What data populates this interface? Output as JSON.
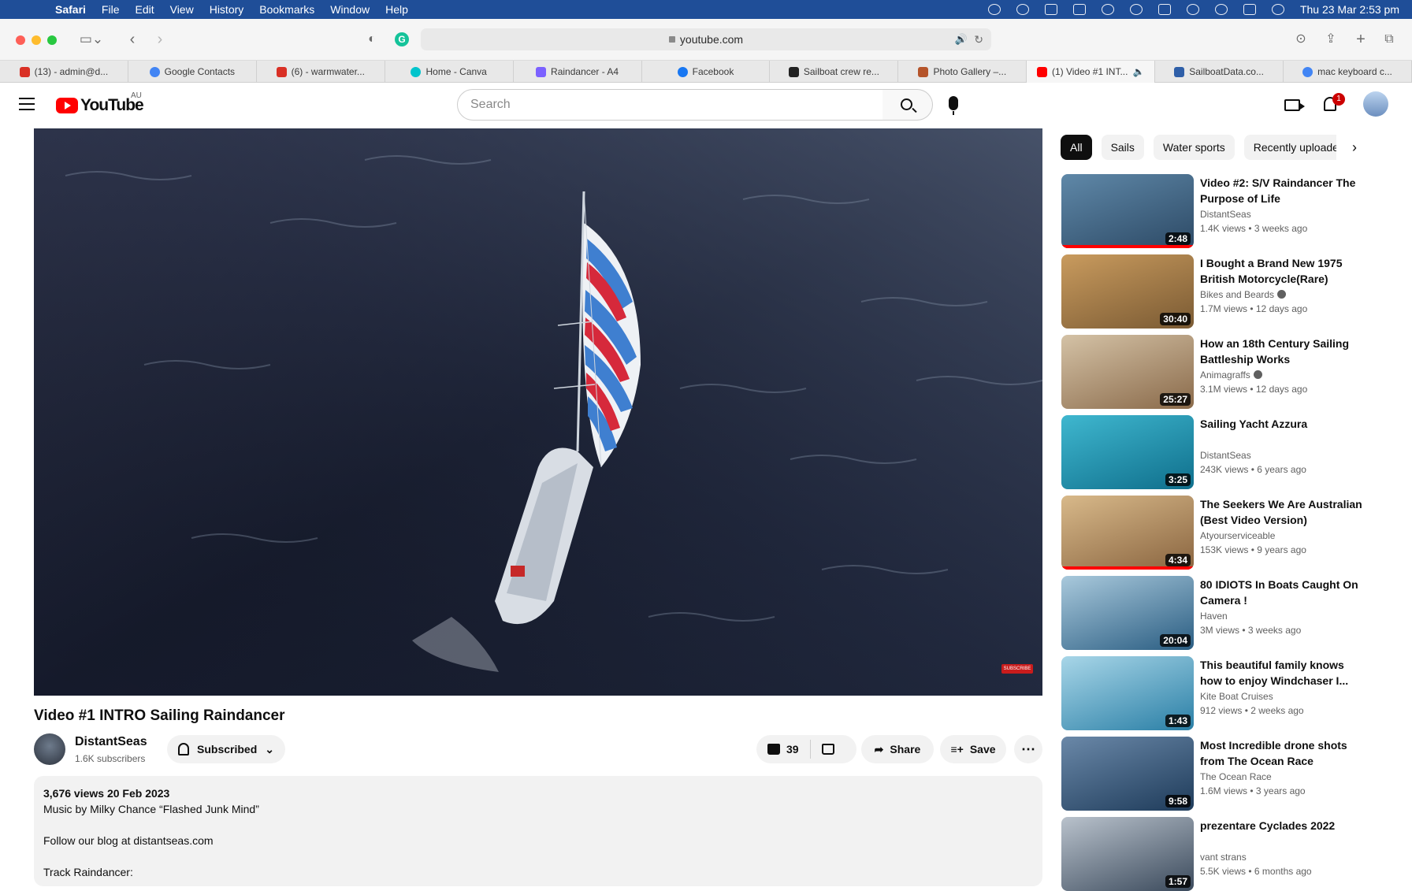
{
  "menubar": {
    "app": "Safari",
    "items": [
      "File",
      "Edit",
      "View",
      "History",
      "Bookmarks",
      "Window",
      "Help"
    ],
    "clock": "Thu 23 Mar  2:53 pm"
  },
  "toolbar": {
    "address": "youtube.com"
  },
  "tabs": [
    {
      "label": "(13) - admin@d...",
      "color": "#d93025"
    },
    {
      "label": "Google Contacts",
      "color": "#4285f4"
    },
    {
      "label": "(6) - warmwater...",
      "color": "#d93025"
    },
    {
      "label": "Home - Canva",
      "color": "#00c4cc"
    },
    {
      "label": "Raindancer - A4",
      "color": "#7b61ff"
    },
    {
      "label": "Facebook",
      "color": "#1877f2"
    },
    {
      "label": "Sailboat crew re...",
      "color": "#222222"
    },
    {
      "label": "Photo Gallery –...",
      "color": "#b5542a"
    },
    {
      "label": "(1) Video #1 INT...",
      "color": "#ff0000"
    },
    {
      "label": "SailboatData.co...",
      "color": "#2f5fa8"
    },
    {
      "label": "mac keyboard c...",
      "color": "#4285f4"
    }
  ],
  "youtube": {
    "logo_text": "YouTube",
    "country": "AU",
    "search_placeholder": "Search",
    "notification_count": "1"
  },
  "video": {
    "title": "Video #1 INTRO Sailing Raindancer",
    "channel": "DistantSeas",
    "subscribers": "1.6K subscribers",
    "subscribed_label": "Subscribed",
    "likes": "39",
    "share_label": "Share",
    "save_label": "Save",
    "stats": "3,676 views  20 Feb 2023",
    "description": [
      "Music by Milky Chance “Flashed Junk Mind”",
      "",
      "Follow our blog at distantseas.com",
      "",
      "Track Raindancer:"
    ]
  },
  "chips": [
    "All",
    "Sails",
    "Water sports",
    "Recently uploaded"
  ],
  "recommendations": [
    {
      "title": "Video #2: S/V Raindancer The Purpose of Life",
      "channel": "DistantSeas",
      "verified": false,
      "meta": "1.4K views  •  3 weeks ago",
      "duration": "2:48",
      "watched": 1.0,
      "colors": [
        "#2d4a66",
        "#5f88a8"
      ]
    },
    {
      "title": "I Bought a Brand New 1975 British Motorcycle(Rare)",
      "channel": "Bikes and Beards",
      "verified": true,
      "meta": "1.7M views  •  12 days ago",
      "duration": "30:40",
      "watched": 0,
      "colors": [
        "#7a5a33",
        "#c99b5e"
      ]
    },
    {
      "title": "How an 18th Century Sailing Battleship Works",
      "channel": "Animagraffs",
      "verified": true,
      "meta": "3.1M views  •  12 days ago",
      "duration": "25:27",
      "watched": 0,
      "colors": [
        "#8a6a4a",
        "#d4c2a6"
      ]
    },
    {
      "title": "Sailing Yacht Azzura",
      "channel": "DistantSeas",
      "verified": false,
      "meta": "243K views  •  6 years ago",
      "duration": "3:25",
      "watched": 0,
      "colors": [
        "#0f6f8c",
        "#3fb7cf"
      ]
    },
    {
      "title": "The Seekers We Are Australian (Best Video Version)",
      "channel": "Atyourserviceable",
      "verified": false,
      "meta": "153K views  •  9 years ago",
      "duration": "4:34",
      "watched": 1.0,
      "colors": [
        "#8a6540",
        "#d8b98a"
      ]
    },
    {
      "title": "80 IDIOTS In Boats Caught On Camera !",
      "channel": "Haven",
      "verified": false,
      "meta": "3M views  •  3 weeks ago",
      "duration": "20:04",
      "watched": 0,
      "colors": [
        "#2a5d82",
        "#a9c9dc"
      ]
    },
    {
      "title": "This beautiful family knows how to enjoy Windchaser I...",
      "channel": "Kite Boat Cruises",
      "verified": false,
      "meta": "912 views  •  2 weeks ago",
      "duration": "1:43",
      "watched": 0,
      "colors": [
        "#2a7fa6",
        "#a8d6e8"
      ]
    },
    {
      "title": "Most Incredible drone shots from The Ocean Race",
      "channel": "The Ocean Race",
      "verified": false,
      "meta": "1.6M views  •  3 years ago",
      "duration": "9:58",
      "watched": 0,
      "colors": [
        "#1e3b5a",
        "#6a88a8"
      ]
    },
    {
      "title": "prezentare Cyclades 2022",
      "channel": "vant strans",
      "verified": false,
      "meta": "5.5K views  •  6 months ago",
      "duration": "1:57",
      "watched": 0,
      "colors": [
        "#3b4a5c",
        "#b9c2cc"
      ]
    }
  ]
}
